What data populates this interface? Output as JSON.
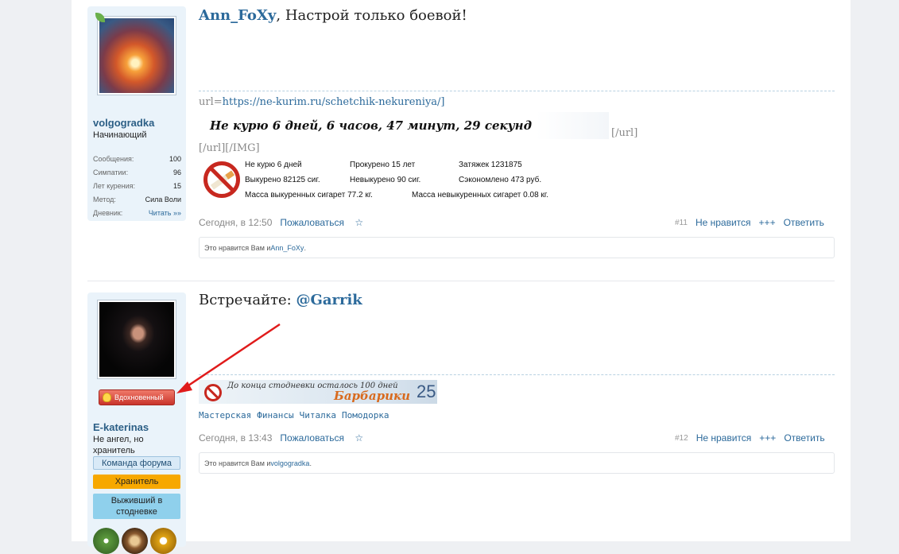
{
  "post1": {
    "user": {
      "name": "volgogradka",
      "title": "Начинающий",
      "stats": [
        {
          "label": "Сообщения:",
          "value": "100"
        },
        {
          "label": "Симпатии:",
          "value": "96"
        },
        {
          "label": "Лет курения:",
          "value": "15"
        },
        {
          "label": "Метод:",
          "value": "Сила Воли"
        },
        {
          "label": "Дневник:",
          "value": "Читать »»"
        }
      ]
    },
    "mention": "Ann_FoXy",
    "text": ", Настрой только боевой!",
    "url_prefix": "url=",
    "url": "https://ne-kurim.ru/schetchik-nekureniya/]",
    "counter_text": "Не курю 6 дней, 6 часов, 47 минут, 29 секунд",
    "url_close": "[/url]",
    "url_img_close": "[/url][/IMG]",
    "nosmoke": {
      "r1c1": "Не курю 6 дней",
      "r1c2": "Прокурено 15 лет",
      "r1c3": "Затяжек 1231875",
      "r2c1": "Выкурено 82125 сиг.",
      "r2c2": "Невыкурено 90 сиг.",
      "r2c3": "Сэкономлено 473 руб.",
      "r3c1": "Масса выкуренных сигарет 77.2 кг.",
      "r3c2": "Масса невыкуренных сигарет 0.08 кг."
    },
    "time": "Сегодня, в 12:50",
    "report": "Пожаловаться",
    "star": "☆",
    "num": "#11",
    "unlike": "Не нравится",
    "plus": "+++",
    "reply": "Ответить",
    "likes_prefix": "Это нравится Вам и ",
    "likes_user": "Ann_FoXy",
    "likes_suffix": "."
  },
  "post2": {
    "user": {
      "name": "E-katerinas",
      "title": "Не ангел, но хранитель",
      "badge": "Вдохновенный",
      "tag_team": "Команда форума",
      "tag_keeper": "Хранитель",
      "tag_surv": "Выживший в стодневке"
    },
    "text": "Встречайте: ",
    "mention": "@Garrik",
    "strip_text": "До конца стодневки осталось 100 дней",
    "strip_brand": "Барбарики",
    "strip_num": "25",
    "links": [
      "Мастерская",
      "Финансы",
      "Читалка",
      "Помодорка"
    ],
    "time": "Сегодня, в 13:43",
    "report": "Пожаловаться",
    "star": "☆",
    "num": "#12",
    "unlike": "Не нравится",
    "plus": "+++",
    "reply": "Ответить",
    "likes_prefix": "Это нравится Вам и ",
    "likes_user": "volgogradka",
    "likes_suffix": "."
  },
  "colors": {
    "accent": "#2c6a9b",
    "badge": "#c9342b",
    "keeper": "#f7a800",
    "survivor": "#8fd0ec",
    "arrow": "#e01b1b"
  }
}
